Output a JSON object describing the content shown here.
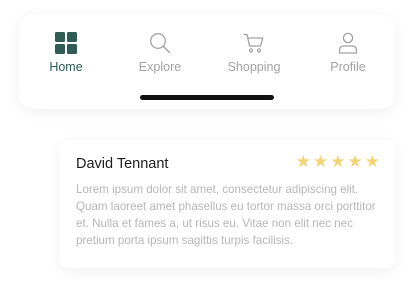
{
  "nav": {
    "items": [
      {
        "label": "Home",
        "icon": "grid-icon",
        "active": true
      },
      {
        "label": "Explore",
        "icon": "search-icon",
        "active": false
      },
      {
        "label": "Shopping",
        "icon": "cart-icon",
        "active": false
      },
      {
        "label": "Profile",
        "icon": "user-icon",
        "active": false
      }
    ]
  },
  "colors": {
    "active": "#2f5c55",
    "inactive": "#a2a2a2",
    "star": "#f2d477"
  },
  "review": {
    "name": "David Tennant",
    "rating": 5,
    "stars": [
      "★",
      "★",
      "★",
      "★",
      "★"
    ],
    "text": "Lorem ipsum dolor sit amet, consectetur adipiscing elit. Quam laoreet amet phasellus eu tortor massa orci porttitor et. Nulla et fames a, ut risus eu. Vitae non elit nec nec pretium porta ipsum sagittis turpis facilisis."
  }
}
